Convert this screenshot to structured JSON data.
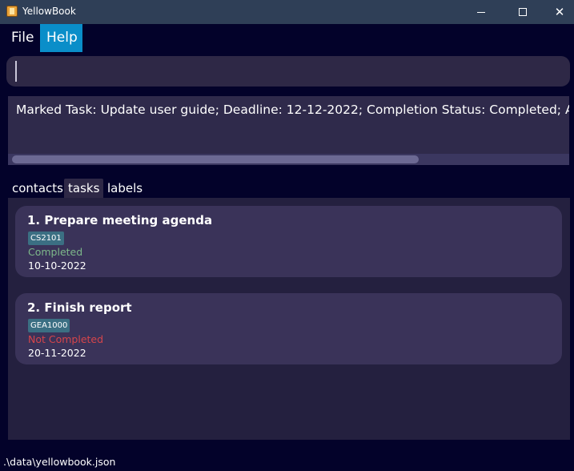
{
  "window": {
    "title": "YellowBook",
    "icons": {
      "app": "yellowbook-app-icon",
      "minimize": "minimize-icon",
      "maximize": "maximize-icon",
      "close": "close-icon"
    },
    "close_glyph": "✕"
  },
  "menu": {
    "items": [
      {
        "label": "File"
      },
      {
        "label": "Help"
      }
    ],
    "selected": "Help",
    "accent": "#0a8ec9"
  },
  "command": {
    "value": ""
  },
  "result": {
    "text": "Marked Task: Update user guide; Deadline: 12-12-2022; Completion Status: Completed; Archival"
  },
  "tabs": {
    "items": [
      {
        "label": "contacts"
      },
      {
        "label": "tasks"
      },
      {
        "label": "labels"
      }
    ],
    "selected": "tasks"
  },
  "tasks": [
    {
      "index": "1.",
      "name": "Prepare meeting agenda",
      "display": "1.  Prepare meeting agenda",
      "label": "CS2101",
      "status": "Completed",
      "deadline": "10-10-2022"
    },
    {
      "index": "2.",
      "name": "Finish report",
      "display": "2.  Finish report",
      "label": "GEA1000",
      "status": "Not Completed",
      "deadline": "20-11-2022"
    }
  ],
  "colors": {
    "completed": "#7db88a",
    "not_completed": "#d6454b",
    "label_chip": "#3b6f83",
    "background": "#03022a"
  },
  "statusbar": {
    "path": ".\\data\\yellowbook.json"
  }
}
